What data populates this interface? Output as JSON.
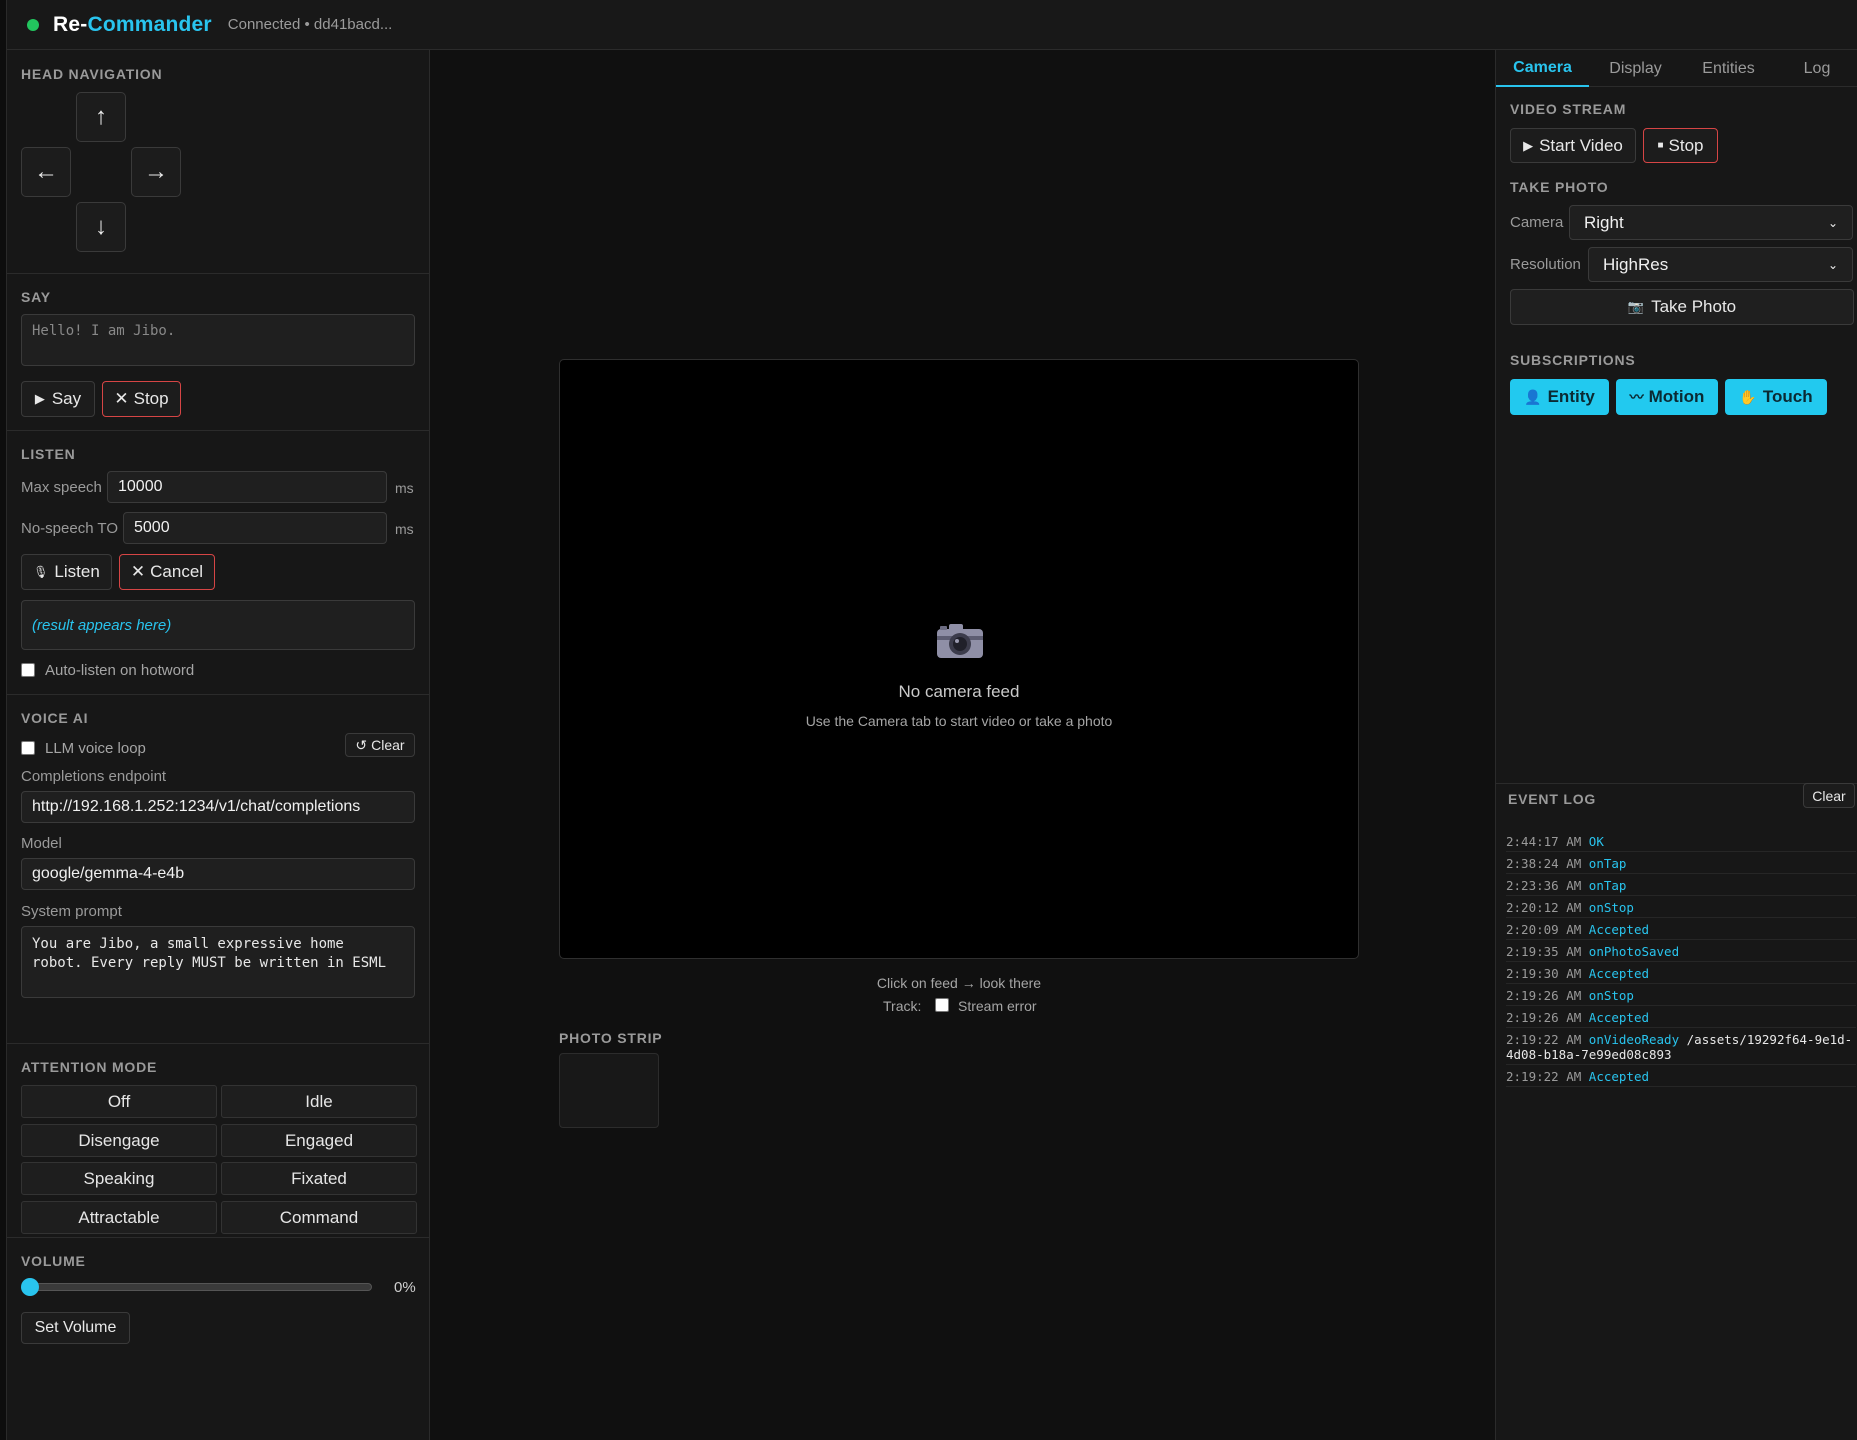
{
  "header": {
    "title_main": "Re-",
    "title_accent": "Commander",
    "connection": "Connected • dd41bacd...",
    "status_color": "#22c55e"
  },
  "head_navigation": {
    "title": "HEAD NAVIGATION",
    "up": "↑",
    "left": "←",
    "right": "→",
    "down": "↓"
  },
  "say": {
    "title": "SAY",
    "placeholder": "Hello! I am Jibo.",
    "say_label": "Say",
    "stop_label": "Stop"
  },
  "listen": {
    "title": "LISTEN",
    "max_speech_label": "Max speech",
    "max_speech_value": "10000",
    "no_speech_label": "No-speech TO",
    "no_speech_value": "5000",
    "unit": "ms",
    "listen_label": "Listen",
    "cancel_label": "Cancel",
    "result_placeholder": "(result appears here)",
    "auto_listen_label": "Auto-listen on hotword"
  },
  "voice_ai": {
    "title": "VOICE AI",
    "llm_loop_label": "LLM voice loop",
    "clear_label": "Clear",
    "endpoint_label": "Completions endpoint",
    "endpoint_value": "http://192.168.1.252:1234/v1/chat/completions",
    "model_label": "Model",
    "model_value": "google/gemma-4-e4b",
    "system_prompt_label": "System prompt",
    "system_prompt_value": "You are Jibo, a small expressive home robot. Every reply MUST be written in ESML"
  },
  "attention_mode": {
    "title": "ATTENTION MODE",
    "modes": [
      "Off",
      "Idle",
      "Disengage",
      "Engaged",
      "Speaking",
      "Fixated",
      "Attractable",
      "Command"
    ]
  },
  "volume": {
    "title": "VOLUME",
    "value": 0,
    "value_label": "0%",
    "set_label": "Set Volume"
  },
  "camera_feed": {
    "title": "No camera feed",
    "subtitle": "Use the Camera tab to start video or take a photo",
    "hint": "Click on feed → look there",
    "track_label": "Track:",
    "stream_error_label": "Stream error",
    "photo_strip_title": "PHOTO STRIP"
  },
  "right_panel": {
    "tabs": [
      "Camera",
      "Display",
      "Entities",
      "Log"
    ],
    "active_tab": "Camera",
    "video_stream_title": "VIDEO STREAM",
    "start_video_label": "Start Video",
    "stop_label": "Stop",
    "take_photo_title": "TAKE PHOTO",
    "camera_label": "Camera",
    "camera_value": "Right",
    "resolution_label": "Resolution",
    "resolution_value": "HighRes",
    "take_photo_label": "Take Photo",
    "subscriptions_title": "SUBSCRIPTIONS",
    "subscriptions": [
      "Entity",
      "Motion",
      "Touch"
    ],
    "accent_color": "#22c9ef"
  },
  "event_log": {
    "title": "EVENT LOG",
    "clear_label": "Clear",
    "entries": [
      {
        "time": "2:44:17 AM",
        "event": "OK",
        "arg": ""
      },
      {
        "time": "2:38:24 AM",
        "event": "onTap",
        "arg": ""
      },
      {
        "time": "2:23:36 AM",
        "event": "onTap",
        "arg": ""
      },
      {
        "time": "2:20:12 AM",
        "event": "onStop",
        "arg": ""
      },
      {
        "time": "2:20:09 AM",
        "event": "Accepted",
        "arg": ""
      },
      {
        "time": "2:19:35 AM",
        "event": "onPhotoSaved",
        "arg": ""
      },
      {
        "time": "2:19:30 AM",
        "event": "Accepted",
        "arg": ""
      },
      {
        "time": "2:19:26 AM",
        "event": "onStop",
        "arg": ""
      },
      {
        "time": "2:19:26 AM",
        "event": "Accepted",
        "arg": ""
      },
      {
        "time": "2:19:22 AM",
        "event": "onVideoReady",
        "arg": "/assets/19292f64-9e1d-4d08-b18a-7e99ed08c893"
      },
      {
        "time": "2:19:22 AM",
        "event": "Accepted",
        "arg": ""
      }
    ]
  }
}
